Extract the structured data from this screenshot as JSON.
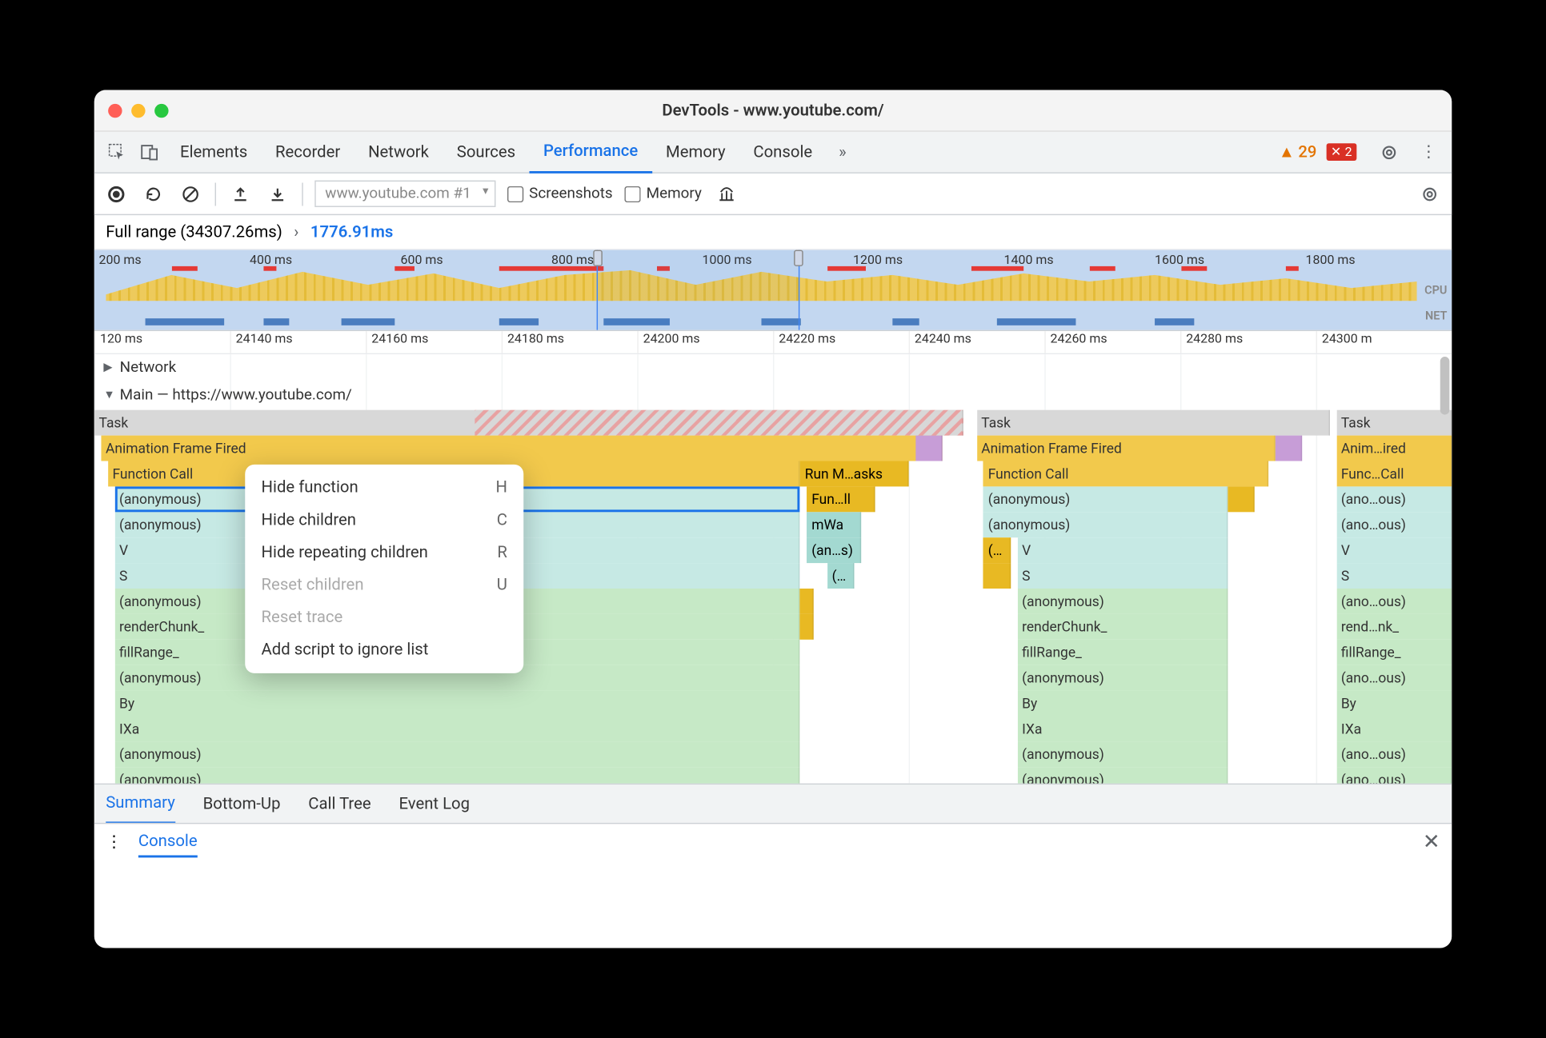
{
  "window_title": "DevTools - www.youtube.com/",
  "tabs": [
    "Elements",
    "Recorder",
    "Network",
    "Sources",
    "Performance",
    "Memory",
    "Console"
  ],
  "active_tab": "Performance",
  "warnings": 29,
  "errors": 2,
  "toolbar": {
    "select_label": "www.youtube.com #1",
    "cb_screenshots": "Screenshots",
    "cb_memory": "Memory"
  },
  "breadcrumb": {
    "full": "Full range (34307.26ms)",
    "selected": "1776.91ms"
  },
  "overview_ticks": [
    "200 ms",
    "400 ms",
    "600 ms",
    "800 ms",
    "1000 ms",
    "1200 ms",
    "1400 ms",
    "1600 ms",
    "1800 ms"
  ],
  "overview_labels": {
    "cpu": "CPU",
    "net": "NET"
  },
  "ruler_ticks": [
    "120 ms",
    "24140 ms",
    "24160 ms",
    "24180 ms",
    "24200 ms",
    "24220 ms",
    "24240 ms",
    "24260 ms",
    "24280 ms",
    "24300 m"
  ],
  "tree": {
    "network": "Network",
    "main": "Main — https://www.youtube.com/"
  },
  "labels": {
    "task": "Task",
    "aff": "Animation Frame Fired",
    "aff3": "Anim…ired",
    "fc": "Function Call",
    "fc3": "Func…Call",
    "run": "Run M…asks",
    "anon": "(anonymous)",
    "anon_s": "(ano…ous)",
    "fun2": "Fun…ll",
    "mwa": "mWa",
    "ans": "(an…s)",
    "dots": "(…",
    "v": "V",
    "s": "S",
    "rc": "renderChunk_",
    "rc3": "rend…nk_",
    "fr": "fillRange_",
    "by": "By",
    "ixa": "IXa"
  },
  "context_menu": [
    {
      "label": "Hide function",
      "key": "H",
      "disabled": false
    },
    {
      "label": "Hide children",
      "key": "C",
      "disabled": false
    },
    {
      "label": "Hide repeating children",
      "key": "R",
      "disabled": false
    },
    {
      "label": "Reset children",
      "key": "U",
      "disabled": true
    },
    {
      "label": "Reset trace",
      "key": "",
      "disabled": true
    },
    {
      "label": "Add script to ignore list",
      "key": "",
      "disabled": false
    }
  ],
  "bottom_tabs": [
    "Summary",
    "Bottom-Up",
    "Call Tree",
    "Event Log"
  ],
  "drawer": {
    "label": "Console"
  }
}
